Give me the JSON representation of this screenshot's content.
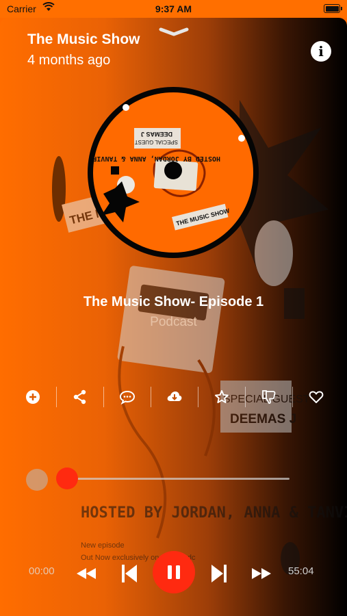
{
  "status": {
    "carrier": "Carrier",
    "time": "9:37 AM"
  },
  "header": {
    "title": "The Music Show",
    "subtitle": "4 months ago"
  },
  "album": {
    "hosted_by": "HOSTED BY JORDAN, ANNA & TANVIR",
    "special_guest": "SPECIAL GUEST",
    "guest_name": "DEEMAS J",
    "show_name": "THE MUSIC SHOW"
  },
  "background": {
    "special_guest": "SPECIAL GUEST",
    "guest_name": "DEEMAS J",
    "hosted_by": "HOSTED BY JORDAN, ANNA & TANVIR",
    "new_episode": "New episode",
    "out_now": "Out Now exclusively on www.podc",
    "show_name": "THE MUSIC"
  },
  "track": {
    "title": "The Music Show- Episode 1",
    "subtitle": "Podcast"
  },
  "actions": [
    "add-icon",
    "share-icon",
    "comment-icon",
    "download-icon",
    "star-icon",
    "thumbs-down-icon",
    "heart-icon"
  ],
  "player": {
    "elapsed": "00:00",
    "total": "55:04",
    "progress": 0
  },
  "colors": {
    "accent": "#ff2a10",
    "brand": "#ff6d00"
  }
}
